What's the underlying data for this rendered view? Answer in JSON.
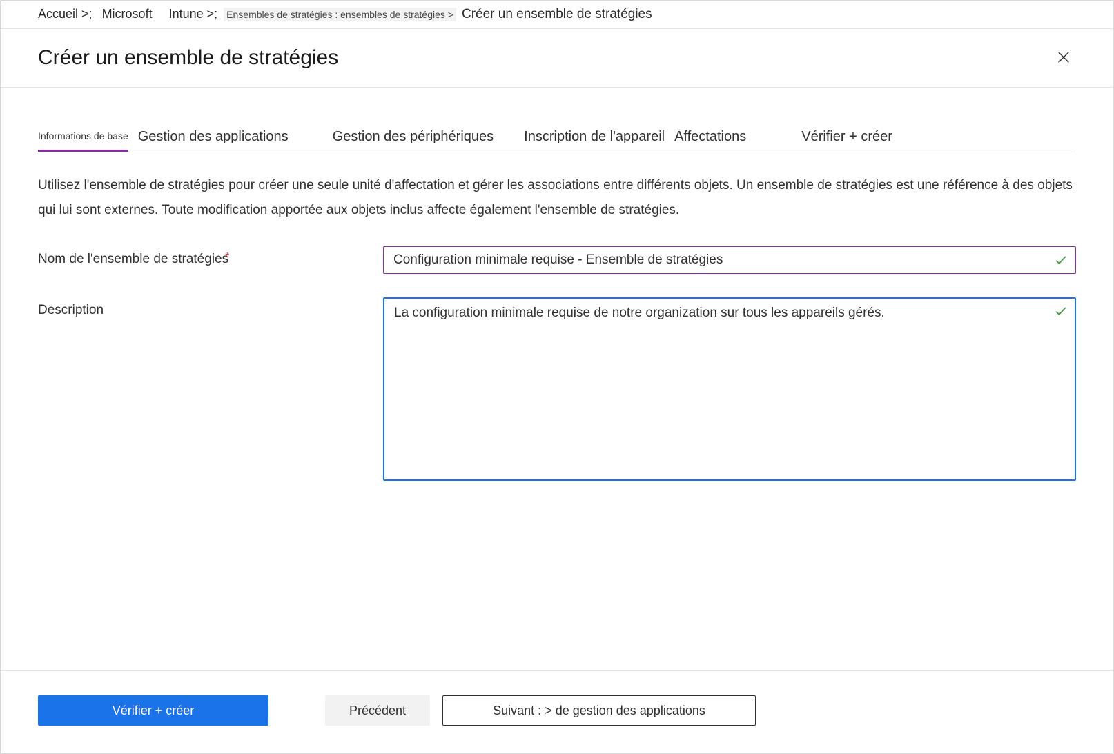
{
  "breadcrumb": {
    "home": "Accueil &gt;;",
    "l1a": "Microsoft",
    "l1b": "Intune &gt;;",
    "l2": "Ensembles de stratégies : ensembles de stratégies &gt;",
    "current": "Créer un ensemble de stratégies"
  },
  "header": {
    "title": "Créer un ensemble de stratégies"
  },
  "tabs": {
    "t0": "Informations de base",
    "t1": "Gestion des applications",
    "t2": "Gestion des périphériques",
    "t3": "Inscription de l'appareil",
    "t4": "Affectations",
    "t5": "Vérifier + créer"
  },
  "intro": "Utilisez l'ensemble de stratégies pour créer une seule unité d'affectation et gérer les associations entre différents objets. Un ensemble de stratégies est une référence à des objets qui lui sont externes. Toute modification apportée aux objets inclus affecte également l'ensemble de stratégies.",
  "form": {
    "name_label": "Nom de l'ensemble de stratégies",
    "name_value": "Configuration minimale requise - Ensemble de stratégies",
    "desc_label": "Description",
    "desc_value": "La configuration minimale requise de notre organization sur tous les appareils gérés."
  },
  "footer": {
    "review": "Vérifier + créer",
    "prev": "Précédent",
    "next": "Suivant : &gt; de gestion des applications"
  }
}
